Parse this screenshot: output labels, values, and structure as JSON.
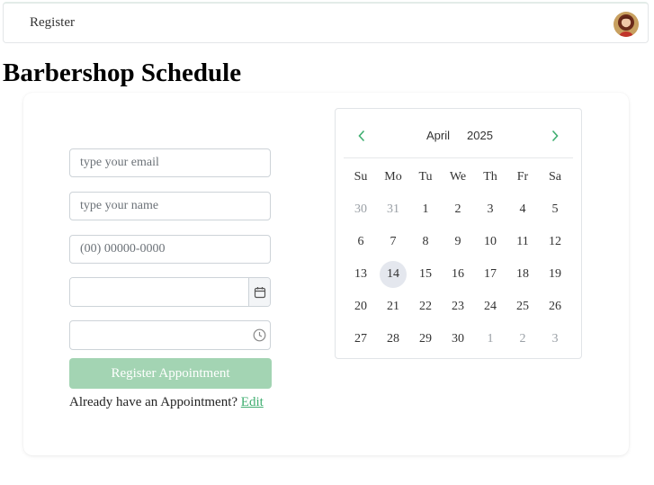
{
  "nav": {
    "register_label": "Register",
    "avatar_label": "user avatar"
  },
  "page": {
    "title": "Barbershop Schedule"
  },
  "form": {
    "email_placeholder": "type your email",
    "name_placeholder": "type your name",
    "phone_placeholder": "(00) 00000-0000",
    "date_value": "",
    "time_value": "",
    "submit_label": "Register Appointment",
    "already_text": "Already have an Appointment?",
    "edit_link": "Edit"
  },
  "calendar": {
    "month": "April",
    "year": "2025",
    "weekdays": [
      "Su",
      "Mo",
      "Tu",
      "We",
      "Th",
      "Fr",
      "Sa"
    ],
    "selected_day": "14",
    "weeks": [
      [
        {
          "d": "30",
          "m": true
        },
        {
          "d": "31",
          "m": true
        },
        {
          "d": "1"
        },
        {
          "d": "2"
        },
        {
          "d": "3"
        },
        {
          "d": "4"
        },
        {
          "d": "5"
        }
      ],
      [
        {
          "d": "6"
        },
        {
          "d": "7"
        },
        {
          "d": "8"
        },
        {
          "d": "9"
        },
        {
          "d": "10"
        },
        {
          "d": "11"
        },
        {
          "d": "12"
        }
      ],
      [
        {
          "d": "13"
        },
        {
          "d": "14",
          "s": true
        },
        {
          "d": "15"
        },
        {
          "d": "16"
        },
        {
          "d": "17"
        },
        {
          "d": "18"
        },
        {
          "d": "19"
        }
      ],
      [
        {
          "d": "20"
        },
        {
          "d": "21"
        },
        {
          "d": "22"
        },
        {
          "d": "23"
        },
        {
          "d": "24"
        },
        {
          "d": "25"
        },
        {
          "d": "26"
        }
      ],
      [
        {
          "d": "27"
        },
        {
          "d": "28"
        },
        {
          "d": "29"
        },
        {
          "d": "30"
        },
        {
          "d": "1",
          "m": true
        },
        {
          "d": "2",
          "m": true
        },
        {
          "d": "3",
          "m": true
        }
      ]
    ]
  },
  "colors": {
    "accent": "#3fae70",
    "button_bg": "#a3d4b3",
    "selected_day_bg": "#e4e7ee"
  }
}
